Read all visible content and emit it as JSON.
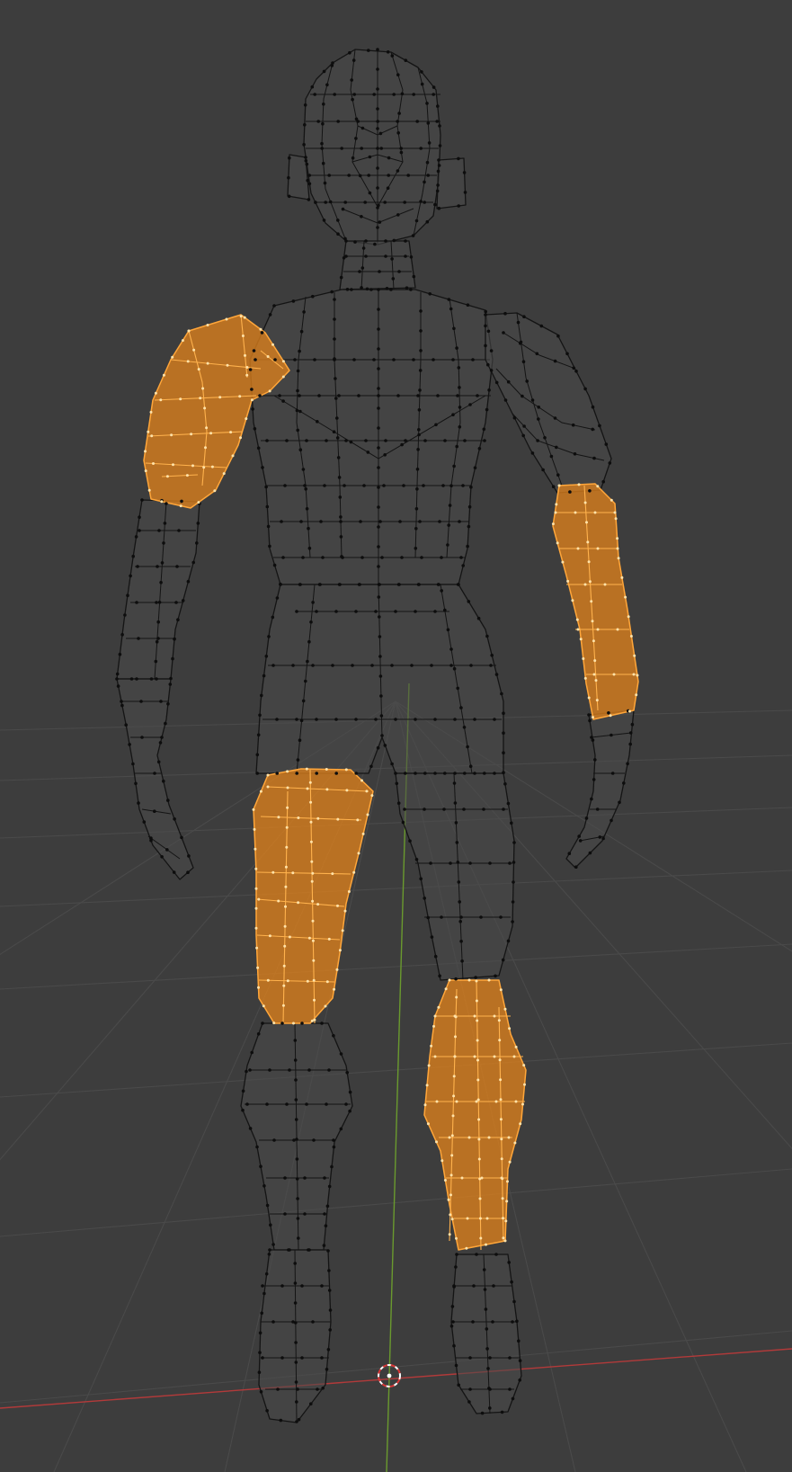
{
  "viewport": {
    "mode": "edit-mode-wireframe",
    "background_color": "#3d3d3d",
    "grid_color": "#4a4a4a",
    "x_axis_color": "#b23a3a",
    "y_axis_color": "#6a9a2e",
    "wire_color": "#141414",
    "selection_color": "#f39c2f",
    "selected_parts": [
      "upper-arm-right",
      "forearm-left",
      "thigh-right",
      "shin-left"
    ],
    "icons": [
      "3d-cursor-icon"
    ]
  }
}
